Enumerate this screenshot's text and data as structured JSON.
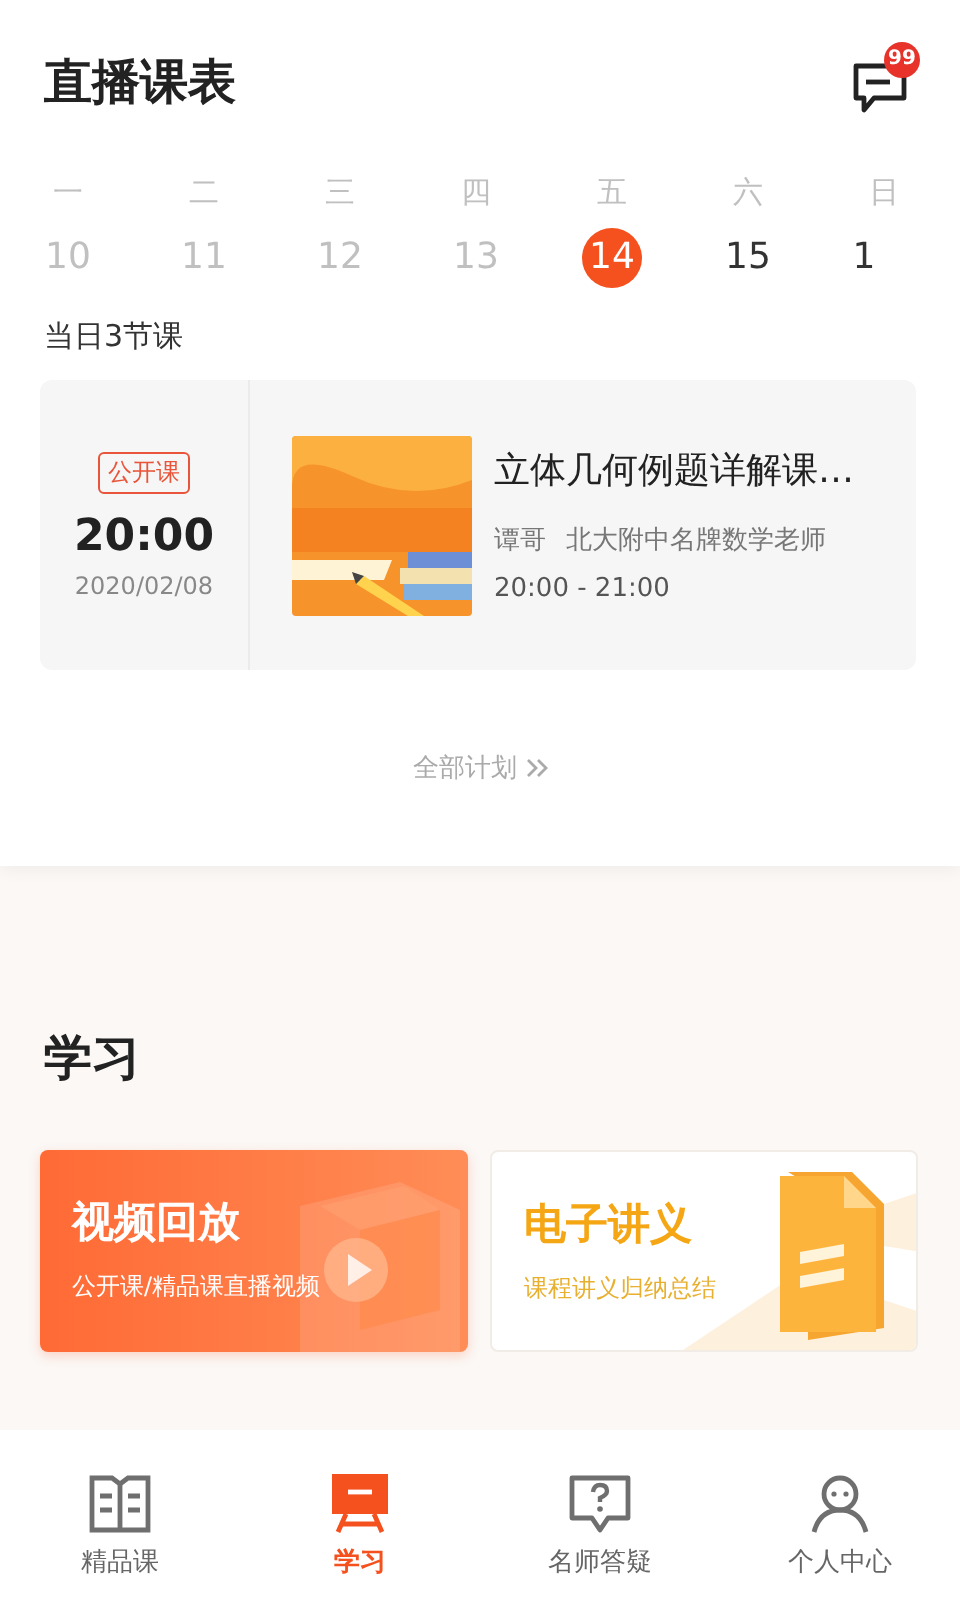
{
  "header": {
    "title": "直播课表",
    "message_badge": "99"
  },
  "week": [
    {
      "weekday": "一",
      "date": "10",
      "past": true,
      "selected": false
    },
    {
      "weekday": "二",
      "date": "11",
      "past": true,
      "selected": false
    },
    {
      "weekday": "三",
      "date": "12",
      "past": true,
      "selected": false
    },
    {
      "weekday": "四",
      "date": "13",
      "past": true,
      "selected": false
    },
    {
      "weekday": "五",
      "date": "14",
      "past": false,
      "selected": true
    },
    {
      "weekday": "六",
      "date": "15",
      "past": false,
      "selected": false
    },
    {
      "weekday": "日",
      "date": "1",
      "past": false,
      "selected": false
    }
  ],
  "lesson_count": "当日3节课",
  "lessons": [
    {
      "tag": "公开课",
      "time": "20:00",
      "date": "2020/02/08",
      "title": "立体几何例题详解课…",
      "teacher": "谭哥",
      "teacher_title": "北大附中名牌数学老师",
      "period": "20:00 - 21:00"
    }
  ],
  "all_plans": "全部计划",
  "study": {
    "title": "学习",
    "cards": [
      {
        "kind": "video",
        "title": "视频回放",
        "subtitle": "公开课/精品课直播视频"
      },
      {
        "kind": "handout",
        "title": "电子讲义",
        "subtitle": "课程讲义归纳总结"
      }
    ]
  },
  "tabs": [
    {
      "kind": "book",
      "label": "精品课",
      "selected": false
    },
    {
      "kind": "board",
      "label": "学习",
      "selected": true
    },
    {
      "kind": "question",
      "label": "名师答疑",
      "selected": false
    },
    {
      "kind": "person",
      "label": "个人中心",
      "selected": false
    }
  ]
}
